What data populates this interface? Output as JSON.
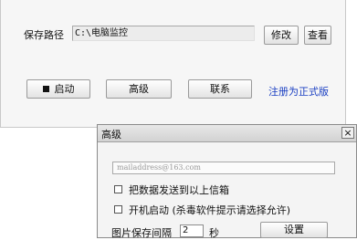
{
  "main": {
    "save_path_label": "保存路径",
    "save_path_value": "C:\\电脑监控",
    "modify_button": "修改",
    "view_button": "查看",
    "start_button": "启动",
    "advanced_button": "高级",
    "contact_button": "联系",
    "register_link": "注册为正式版"
  },
  "dialog": {
    "title": "高级",
    "close_glyph": "×",
    "email_placeholder": "mailaddress@163.com",
    "send_email_option": "把数据发送到以上信箱",
    "autostart_option": "开机启动 (杀毒软件提示请选择允许)",
    "interval_label": "图片保存间隔",
    "interval_value": "2",
    "interval_unit": "秒",
    "settings_button": "设置"
  },
  "colors": {
    "link": "#1a3fc2"
  }
}
